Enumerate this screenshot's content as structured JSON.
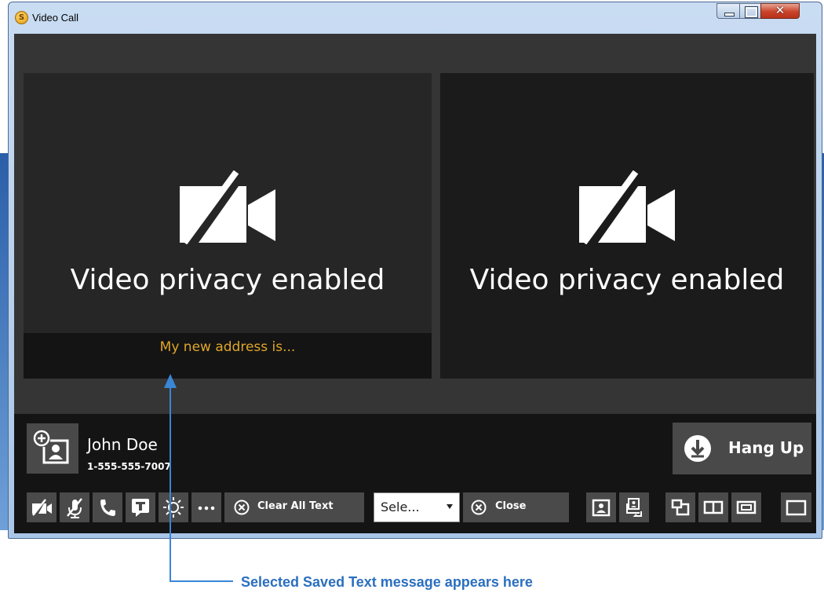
{
  "window": {
    "title": "Video Call",
    "app_icon_letter": "S"
  },
  "panes": {
    "left": {
      "status_text": "Video privacy enabled",
      "caption_text": "My new address is..."
    },
    "right": {
      "status_text": "Video privacy enabled"
    }
  },
  "contact": {
    "name": "John Doe",
    "number": "1-555-555-7007"
  },
  "hang_up": {
    "label": "Hang Up"
  },
  "toolbar": {
    "clear_all_text_label": "Clear All Text",
    "saved_text_select_value": "Sele...",
    "close_label": "Close"
  },
  "annotation": {
    "text": "Selected Saved Text message appears here"
  },
  "colors": {
    "caption_text": "#e0a62a",
    "annotation": "#2a6fbf",
    "panel_background": "#141414",
    "button_background": "#494949"
  },
  "icons": [
    "video-off-icon",
    "mic-off-icon",
    "phone-icon",
    "text-chat-icon",
    "brightness-icon",
    "more-icon",
    "clear-circle-x-icon",
    "close-circle-x-icon",
    "self-view-icon",
    "swap-view-icon",
    "layout-pip-icon",
    "layout-side-by-side-icon",
    "layout-stacked-icon",
    "fullscreen-icon",
    "add-contact-icon",
    "hang-up-icon"
  ]
}
